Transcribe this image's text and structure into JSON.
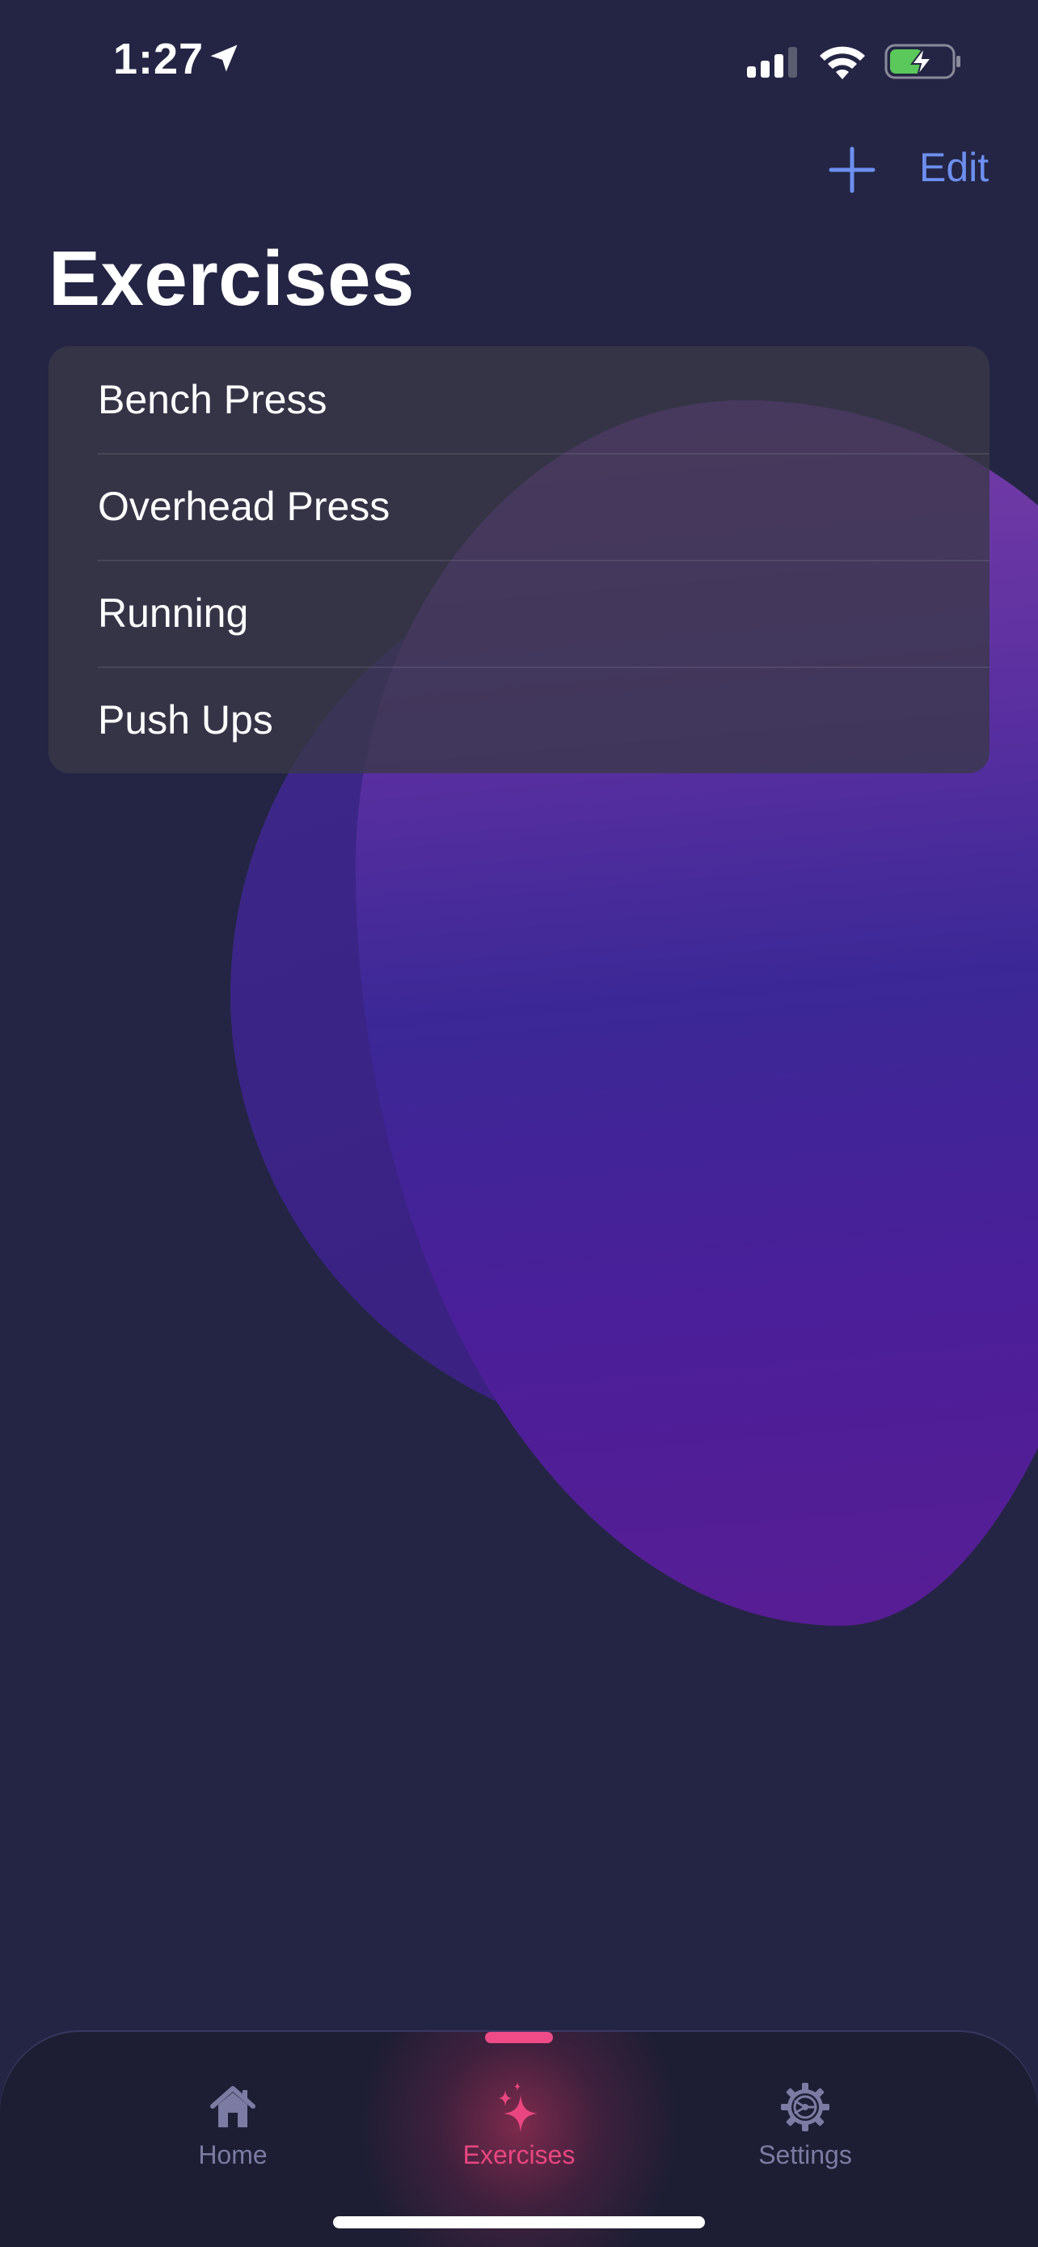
{
  "status_bar": {
    "time": "1:27",
    "icons": [
      "location-arrow-icon",
      "cellular-signal-icon",
      "wifi-icon",
      "battery-charging-icon"
    ],
    "battery_color": "#5ac85a"
  },
  "nav": {
    "add_icon": "plus-icon",
    "edit_label": "Edit",
    "accent_color": "#6d8ff0"
  },
  "page": {
    "title": "Exercises"
  },
  "exercises": [
    {
      "name": "Bench Press"
    },
    {
      "name": "Overhead Press"
    },
    {
      "name": "Running"
    },
    {
      "name": "Push Ups"
    }
  ],
  "tab_bar": {
    "active_color": "#e9467f",
    "inactive_color": "#7b7ba3",
    "tabs": [
      {
        "label": "Home",
        "icon": "house-icon",
        "active": false
      },
      {
        "label": "Exercises",
        "icon": "sparkles-icon",
        "active": true
      },
      {
        "label": "Settings",
        "icon": "gear-icon",
        "active": false
      }
    ]
  }
}
